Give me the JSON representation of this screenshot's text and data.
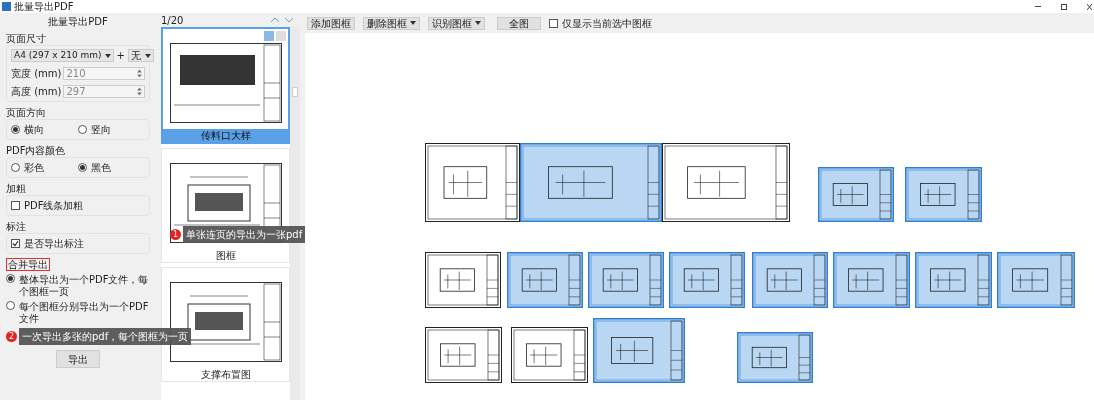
{
  "window": {
    "title": "批量导出PDF"
  },
  "panel": {
    "title": "批量导出PDF",
    "page_size": {
      "label": "页面尺寸",
      "paper": "A4 (297 x 210 mm)",
      "plus": "+",
      "extra": "无",
      "width": {
        "label": "宽度 (mm)",
        "value": "210"
      },
      "height": {
        "label": "高度 (mm)",
        "value": "297"
      }
    },
    "orientation": {
      "label": "页面方向",
      "options": [
        {
          "label": "横向",
          "selected": true
        },
        {
          "label": "竖向",
          "selected": false
        }
      ]
    },
    "color": {
      "label": "PDF内容颜色",
      "options": [
        {
          "label": "彩色",
          "selected": false
        },
        {
          "label": "黑色",
          "selected": true
        }
      ]
    },
    "bold": {
      "label": "加粗",
      "option": {
        "label": "PDF线条加粗",
        "checked": false
      }
    },
    "annotation": {
      "label": "标注",
      "option": {
        "label": "是否导出标注",
        "checked": true
      }
    },
    "merge": {
      "label": "合并导出",
      "options": [
        {
          "label": "整体导出为一个PDF文件，每个图框一页",
          "selected": true
        },
        {
          "label": "每个图框分别导出为一个PDF文件",
          "selected": false
        }
      ]
    },
    "export_button": "导出"
  },
  "tooltips": [
    {
      "badge": "1",
      "text": "单张连页的导出为一张pdf"
    },
    {
      "badge": "2",
      "text": "一次导出多张的pdf，每个图框为一页"
    }
  ],
  "thumbnails": {
    "counter": "1/20",
    "items": [
      {
        "label": "传料口大样",
        "selected": true
      },
      {
        "label": "图框",
        "selected": false
      },
      {
        "label": "支撑布置图",
        "selected": false
      }
    ]
  },
  "toolbar": {
    "buttons": [
      {
        "label": "添加图框",
        "kind": "plain"
      },
      {
        "label": "删除图框",
        "kind": "dropdown"
      },
      {
        "label": "识别图框",
        "kind": "dropdown"
      },
      {
        "label": "全图",
        "kind": "plain"
      }
    ],
    "only_selected": {
      "label": "仅显示当前选中图框",
      "checked": false
    }
  },
  "canvas": {
    "sheets": [
      {
        "selected": false
      },
      {
        "selected": true
      },
      {
        "selected": false
      },
      {
        "selected": true
      },
      {
        "selected": true
      },
      {
        "selected": false
      },
      {
        "selected": true
      },
      {
        "selected": true
      },
      {
        "selected": true
      },
      {
        "selected": true
      },
      {
        "selected": true
      },
      {
        "selected": true
      },
      {
        "selected": true
      },
      {
        "selected": false
      },
      {
        "selected": false
      },
      {
        "selected": true
      },
      {
        "selected": true
      }
    ]
  }
}
